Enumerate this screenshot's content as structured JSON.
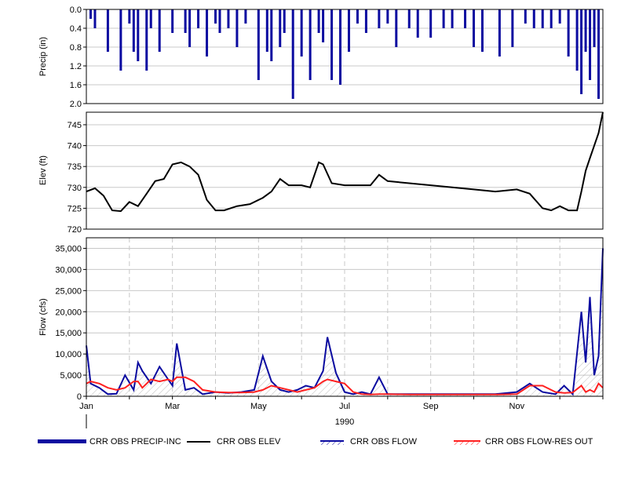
{
  "chart_data": [
    {
      "type": "bar",
      "ylabel": "Precip (in)",
      "ylim": [
        0.0,
        2.0
      ],
      "y_inverted": true,
      "yticks": [
        "0.0",
        "0.4",
        "0.8",
        "1.2",
        "1.6",
        "2.0"
      ],
      "grid": true,
      "color": "#0A0AA0",
      "series_name": "CRR OBS PRECIP-INC",
      "x_month": [
        0.1,
        0.2,
        0.5,
        0.8,
        1.0,
        1.1,
        1.2,
        1.4,
        1.5,
        1.7,
        2.0,
        2.3,
        2.4,
        2.6,
        2.8,
        3.0,
        3.1,
        3.3,
        3.5,
        3.7,
        4.0,
        4.2,
        4.3,
        4.5,
        4.6,
        4.8,
        5.0,
        5.2,
        5.4,
        5.5,
        5.7,
        5.9,
        6.1,
        6.3,
        6.5,
        6.8,
        7.0,
        7.2,
        7.5,
        7.7,
        8.0,
        8.3,
        8.5,
        8.8,
        9.0,
        9.2,
        9.6,
        9.9,
        10.2,
        10.4,
        10.6,
        10.8,
        11.0,
        11.2,
        11.4,
        11.5,
        11.6,
        11.7,
        11.8,
        11.9
      ],
      "precip": [
        0.2,
        0.4,
        0.9,
        1.3,
        0.3,
        0.9,
        1.1,
        1.3,
        0.4,
        0.9,
        0.5,
        0.5,
        0.8,
        0.4,
        1.0,
        0.3,
        0.5,
        0.4,
        0.8,
        0.3,
        1.5,
        0.9,
        1.1,
        0.8,
        0.5,
        1.9,
        1.0,
        1.5,
        0.5,
        0.7,
        1.5,
        1.6,
        0.9,
        0.3,
        0.5,
        0.4,
        0.3,
        0.8,
        0.4,
        0.6,
        0.6,
        0.4,
        0.4,
        0.4,
        0.8,
        0.9,
        1.0,
        0.8,
        0.3,
        0.4,
        0.4,
        0.4,
        0.3,
        1.0,
        1.3,
        1.8,
        0.9,
        1.5,
        0.8,
        1.9
      ]
    },
    {
      "type": "line",
      "ylabel": "Elev (ft)",
      "ylim": [
        720,
        748
      ],
      "yticks": [
        "720",
        "725",
        "730",
        "735",
        "740",
        "745"
      ],
      "grid": true,
      "series_name": "CRR OBS ELEV",
      "color": "#000000",
      "x_month": [
        0.0,
        0.2,
        0.4,
        0.6,
        0.8,
        1.0,
        1.2,
        1.4,
        1.6,
        1.8,
        2.0,
        2.2,
        2.4,
        2.6,
        2.8,
        3.0,
        3.2,
        3.5,
        3.8,
        4.1,
        4.3,
        4.5,
        4.7,
        5.0,
        5.2,
        5.4,
        5.5,
        5.7,
        6.0,
        6.3,
        6.6,
        6.8,
        7.0,
        7.5,
        8.0,
        8.5,
        9.0,
        9.5,
        10.0,
        10.3,
        10.6,
        10.8,
        11.0,
        11.2,
        11.4,
        11.5,
        11.6,
        11.7,
        11.8,
        11.9,
        12.0
      ],
      "elev": [
        729,
        729.8,
        728,
        724.5,
        724.3,
        726.5,
        725.5,
        728.5,
        731.5,
        732,
        735.5,
        736,
        735,
        733,
        727,
        724.5,
        724.5,
        725.5,
        726,
        727.5,
        729,
        732,
        730.5,
        730.5,
        730,
        736,
        735.5,
        731,
        730.5,
        730.5,
        730.5,
        733,
        731.5,
        731,
        730.5,
        730,
        729.5,
        729,
        729.5,
        728.5,
        725,
        724.5,
        725.5,
        724.5,
        724.5,
        729,
        734,
        737,
        740,
        743,
        749
      ]
    },
    {
      "type": "line",
      "ylabel": "Flow (cfs)",
      "ylim": [
        0,
        37500
      ],
      "yticks": [
        "0",
        "5,000",
        "10,000",
        "15,000",
        "20,000",
        "25,000",
        "30,000",
        "35,000"
      ],
      "grid": true,
      "xlabel": "1990",
      "xticks": [
        "Jan",
        "Mar",
        "May",
        "Jul",
        "Sep",
        "Nov"
      ],
      "x_month": [
        0.0,
        0.1,
        0.3,
        0.5,
        0.7,
        0.9,
        1.1,
        1.2,
        1.3,
        1.5,
        1.7,
        1.9,
        2.0,
        2.1,
        2.3,
        2.5,
        2.7,
        3.0,
        3.3,
        3.6,
        3.9,
        4.1,
        4.3,
        4.5,
        4.7,
        4.9,
        5.1,
        5.3,
        5.5,
        5.6,
        5.8,
        6.0,
        6.2,
        6.4,
        6.6,
        6.8,
        7.0,
        7.5,
        8.0,
        8.5,
        9.0,
        9.5,
        10.0,
        10.3,
        10.6,
        10.9,
        11.1,
        11.3,
        11.5,
        11.6,
        11.7,
        11.8,
        11.9,
        12.0
      ],
      "series": [
        {
          "name": "CRR OBS FLOW",
          "color": "#0A0AA0",
          "values": [
            12000,
            3000,
            2000,
            500,
            600,
            5000,
            1500,
            8000,
            6000,
            3000,
            7000,
            4000,
            2500,
            12500,
            1500,
            2000,
            500,
            1000,
            800,
            1000,
            1500,
            9500,
            3500,
            1500,
            1000,
            1500,
            2500,
            2000,
            6000,
            14000,
            5500,
            1000,
            500,
            1000,
            500,
            4500,
            500,
            500,
            500,
            500,
            500,
            500,
            1000,
            3000,
            1000,
            500,
            2500,
            500,
            20000,
            8000,
            23500,
            5000,
            9500,
            35000
          ]
        },
        {
          "name": "CRR OBS FLOW-RES OUT",
          "color": "#FF2020",
          "values": [
            3000,
            3500,
            3000,
            2000,
            1500,
            2000,
            3500,
            3500,
            2000,
            4000,
            3500,
            4000,
            3500,
            4500,
            4500,
            3500,
            1500,
            1000,
            900,
            900,
            1000,
            1500,
            2500,
            2000,
            1500,
            1000,
            1500,
            2000,
            3500,
            4000,
            3500,
            3000,
            1000,
            500,
            400,
            500,
            500,
            400,
            400,
            400,
            400,
            400,
            500,
            2500,
            2500,
            1000,
            800,
            900,
            2500,
            1000,
            1500,
            1000,
            3000,
            2000
          ]
        }
      ]
    }
  ],
  "legend": {
    "position": "bottom",
    "items": [
      {
        "label": "CRR OBS PRECIP-INC",
        "style": "thick-blue"
      },
      {
        "label": "CRR OBS ELEV",
        "style": "black-line"
      },
      {
        "label": "CRR OBS FLOW",
        "style": "blue-hatched"
      },
      {
        "label": "CRR OBS FLOW-RES OUT",
        "style": "red-hatched"
      }
    ]
  }
}
